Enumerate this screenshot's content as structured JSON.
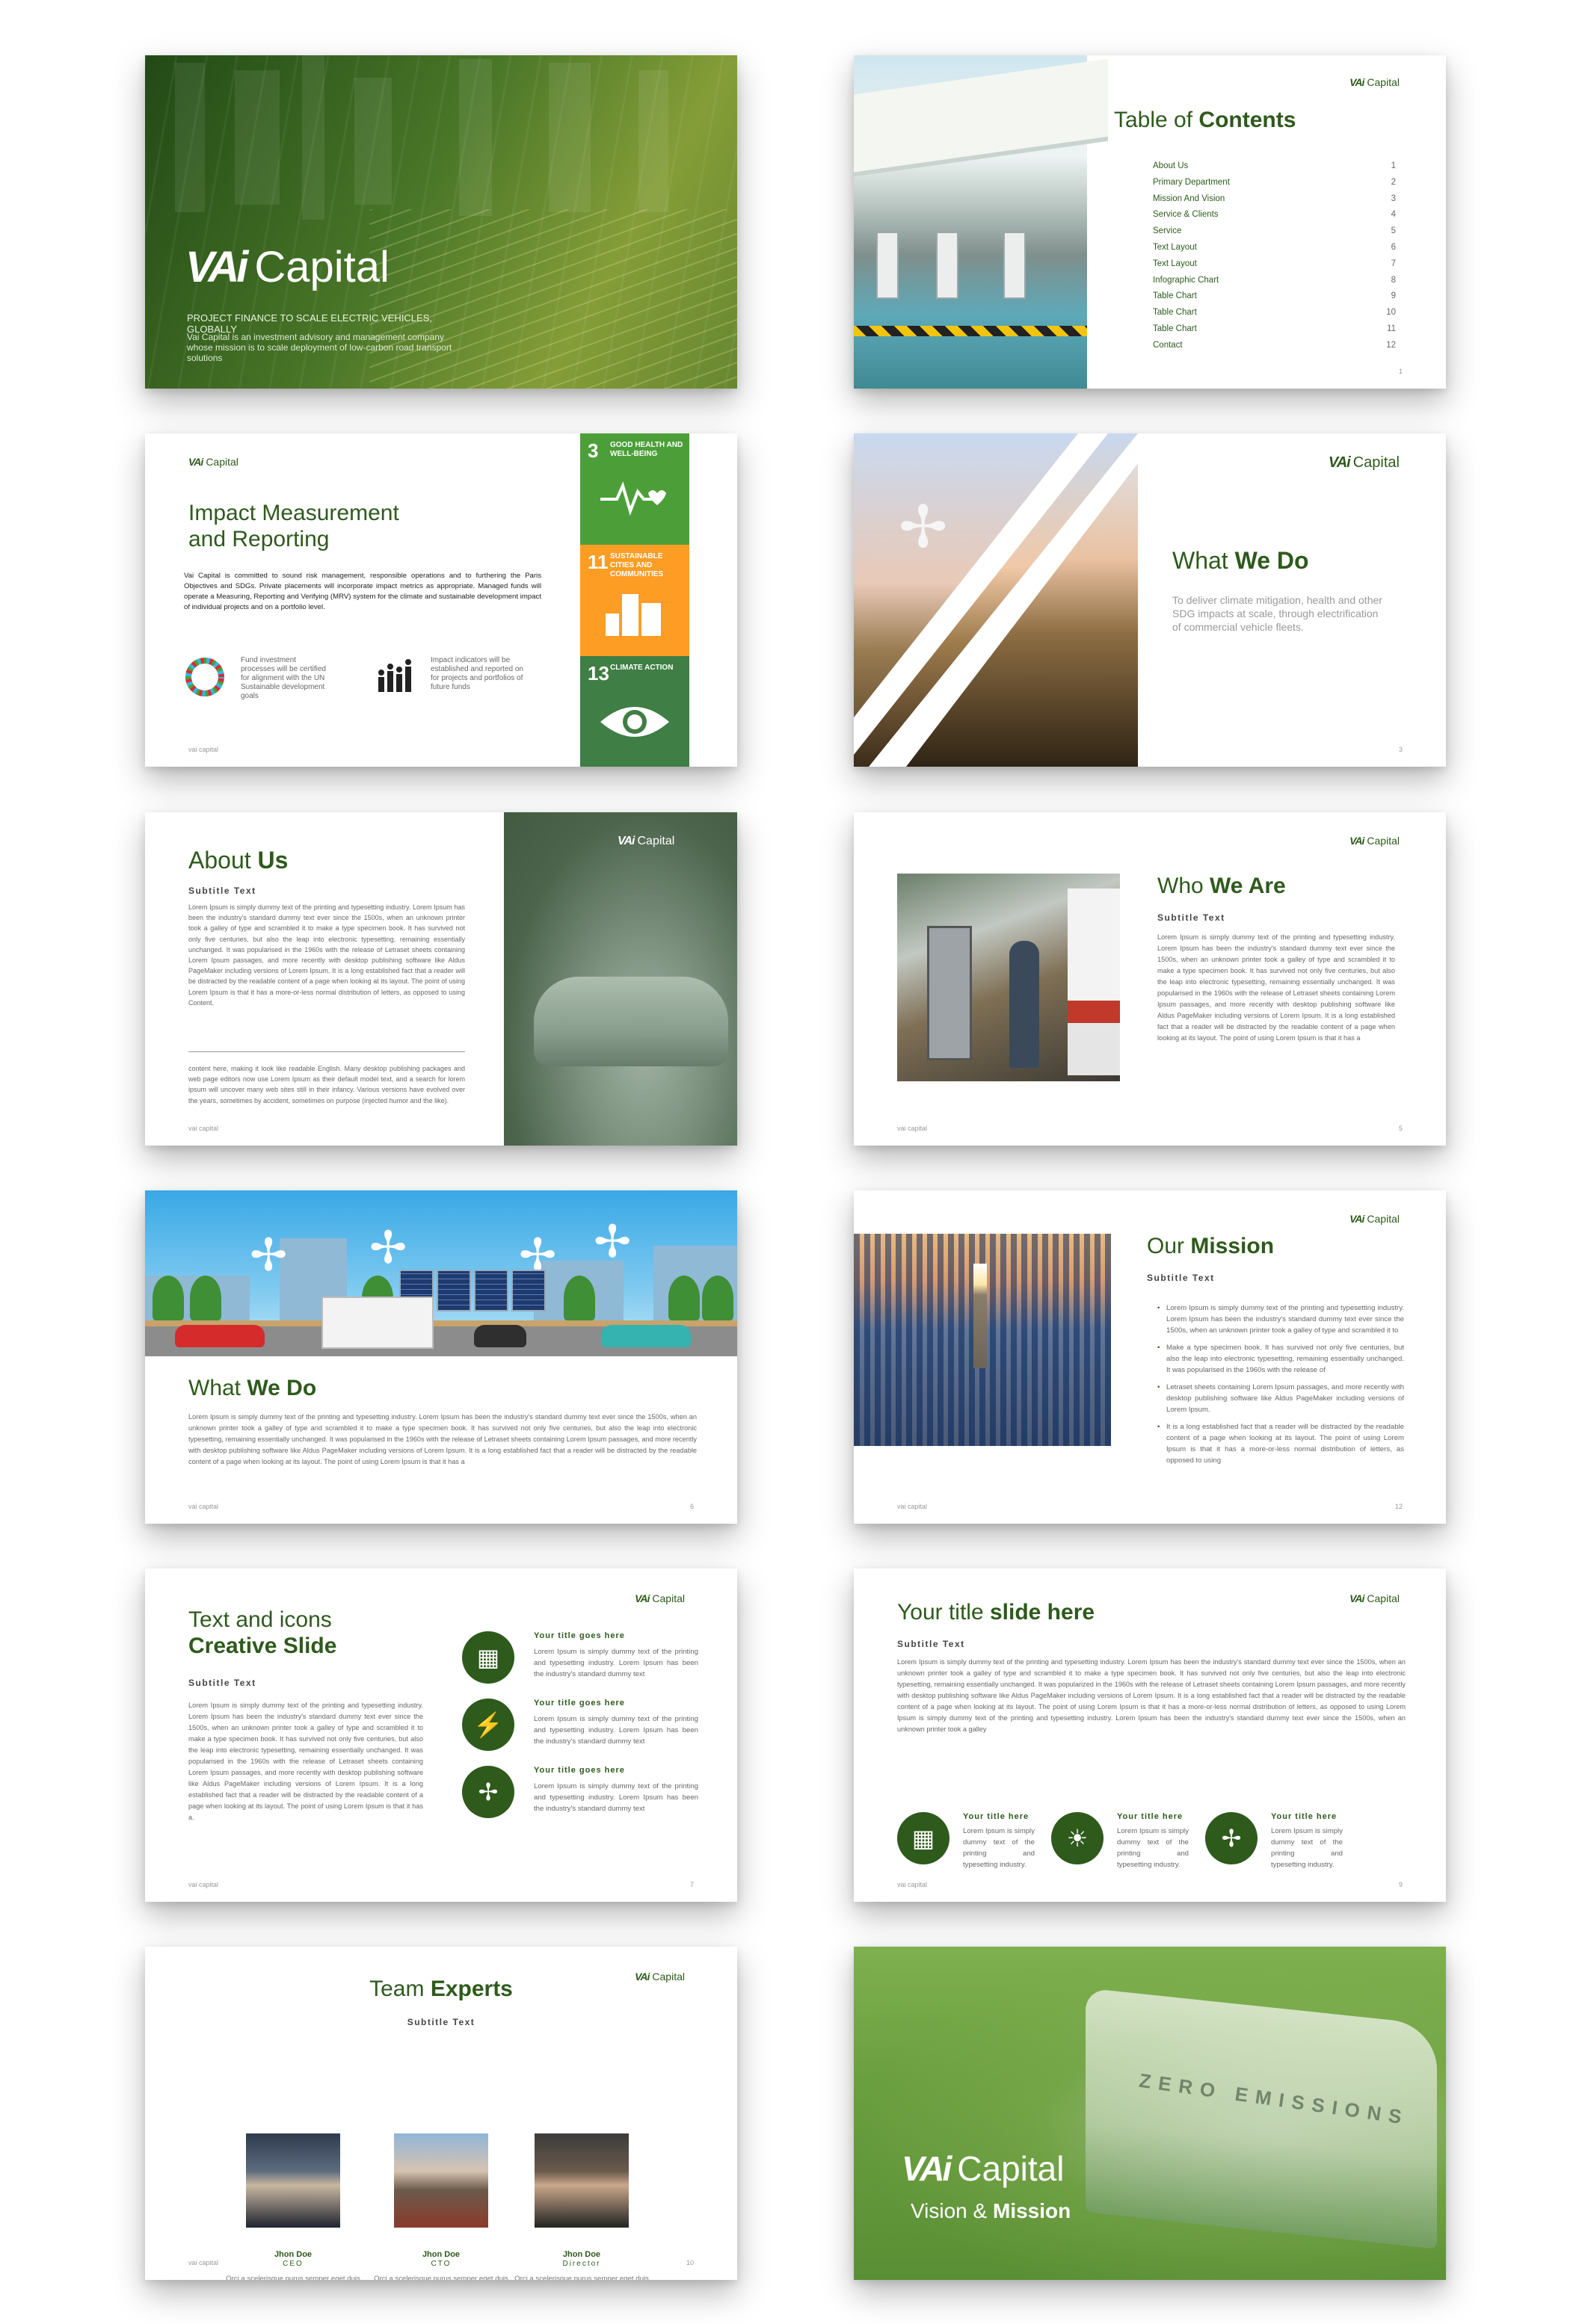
{
  "brand": {
    "mark": "VAi",
    "word": "Capital",
    "footer": "vai capital"
  },
  "cover": {
    "tagline": "PROJECT FINANCE TO SCALE ELECTRIC VEHICLES, GLOBALLY",
    "description": "Vai Capital is an investment advisory and management company whose mission is to scale deployment of low-carbon road transport solutions"
  },
  "toc": {
    "title_a": "Table of ",
    "title_b": "Contents",
    "page": "1",
    "items": [
      {
        "label": "About Us",
        "num": "1"
      },
      {
        "label": "Primary Department",
        "num": "2"
      },
      {
        "label": "Mission And Vision",
        "num": "3"
      },
      {
        "label": "Service & Clients",
        "num": "4"
      },
      {
        "label": "Service",
        "num": "5"
      },
      {
        "label": "Text Layout",
        "num": "6"
      },
      {
        "label": "Text Layout",
        "num": "7"
      },
      {
        "label": "Infographic Chart",
        "num": "8"
      },
      {
        "label": "Table Chart",
        "num": "9"
      },
      {
        "label": "Table Chart",
        "num": "10"
      },
      {
        "label": "Table Chart",
        "num": "11"
      },
      {
        "label": "Contact",
        "num": "12"
      }
    ]
  },
  "impact": {
    "title_a": "Impact ",
    "title_b": "Measurement",
    "title_c": "and Reporting",
    "body": "Vai Capital is committed to sound risk management, responsible operations and to furthering the Paris Objectives and SDGs. Private placements will incorporate impact metrics as appropriate. Managed funds will operate a Measuring, Reporting and Verifying (MRV) system for the climate and sustainable development impact of individual projects and on a portfolio level.",
    "feat1": "Fund investment processes will be certified for alignment with the UN Sustainable development goals",
    "feat2": "Impact indicators will be established and reported on for projects and portfolios of future funds",
    "page": "2",
    "sdgs": [
      {
        "num": "3",
        "label": "GOOD HEALTH AND WELL-BEING",
        "color": "#4c9f38",
        "icon": "heartbeat-icon"
      },
      {
        "num": "11",
        "label": "SUSTAINABLE CITIES AND COMMUNITIES",
        "color": "#fd9d24",
        "icon": "city-icon"
      },
      {
        "num": "13",
        "label": "CLIMATE ACTION",
        "color": "#3f7e44",
        "icon": "eye-globe-icon"
      }
    ]
  },
  "whatwedo1": {
    "title_a": "What ",
    "title_b": "We Do",
    "body": "To deliver climate mitigation, health and other SDG impacts at scale, through electrification of commercial vehicle fleets.",
    "page": "3"
  },
  "about": {
    "title_a": "About ",
    "title_b": "Us",
    "subtitle": "Subtitle Text",
    "body": "Lorem Ipsum is simply dummy text of the printing and typesetting industry. Lorem Ipsum has been the industry's standard dummy text ever since the 1500s, when an unknown printer took a galley of type and scrambled it to make a type specimen book. It has survived not only five centuries, but also the leap into electronic typesetting, remaining essentially unchanged. It was popularised in the 1960s with the release of Letraset sheets containing Lorem Ipsum passages, and more recently with desktop publishing software like Aldus PageMaker including versions of Lorem Ipsum. It is a long established fact that a reader will be distracted by the readable content of a page when looking at its layout. The point of using Lorem Ipsum is that it has a more-or-less normal distribution of letters, as opposed to using Content.",
    "body2": "content here, making it look like readable English. Many desktop publishing packages and web page editors now use Lorem Ipsum as their default model text, and a search for lorem ipsum will uncover many web sites still in their infancy. Various versions have evolved over the years, sometimes by accident, sometimes on purpose (injected humor and the like).",
    "page": "4"
  },
  "who": {
    "title_a": "Who ",
    "title_b": "We Are",
    "subtitle": "Subtitle Text",
    "body": "Lorem Ipsum is simply dummy text of the printing and typesetting industry. Lorem Ipsum has been the industry's standard dummy text ever since the 1500s, when an unknown printer took a galley of type and scrambled it to make a type specimen book. It has survived not only five centuries, but also the leap into electronic typesetting, remaining essentially unchanged. It was popularised in the 1960s with the release of Letraset sheets containing Lorem Ipsum passages, and more recently with desktop publishing software like Aldus PageMaker including versions of Lorem Ipsum. It is a long established fact that a reader will be distracted by the readable content of a page when looking at its layout. The point of using Lorem Ipsum is that it has a",
    "page": "5"
  },
  "whatwedo2": {
    "title_a": "What ",
    "title_b": "We Do",
    "body": "Lorem Ipsum is simply dummy text of the printing and typesetting industry. Lorem Ipsum has been the industry's standard dummy text ever since the 1500s, when an unknown printer took a galley of type and scrambled it to make a type specimen book. It has survived not only five centuries, but also the leap into electronic typesetting, remaining essentially unchanged. It was popularised in the 1960s with the release of Letraset sheets containing Lorem Ipsum passages, and more recently with desktop publishing software like Aldus PageMaker including versions of Lorem Ipsum. It is a long established fact that a reader will be distracted by the readable content of a page when looking at its layout. The point of using Lorem Ipsum is that it has a",
    "page": "6"
  },
  "mission": {
    "title_a": "Our ",
    "title_b": "Mission",
    "subtitle": "Subtitle Text",
    "bullets": [
      "Lorem Ipsum is simply dummy text of the printing and typesetting industry. Lorem Ipsum has been the industry's standard dummy text ever since the 1500s, when an unknown printer took a galley of type and scrambled it to",
      "Make a type specimen book. It has survived not only five centuries, but also the leap into electronic typesetting, remaining essentially unchanged. It was popularised in the 1960s with the release of",
      "Letraset sheets containing Lorem Ipsum passages, and more recently with desktop publishing software like Aldus PageMaker including versions of Lorem Ipsum.",
      "It is a long established fact that a reader will be distracted by the readable content of a page when looking at its layout. The point of using Lorem Ipsum is that it has a more-or-less normal distribution of letters, as opposed to using"
    ],
    "page": "12"
  },
  "creative": {
    "title_a": "Text and icons",
    "title_b": "Creative Slide",
    "subtitle": "Subtitle Text",
    "body": "Lorem Ipsum is simply dummy text of the printing and typesetting industry. Lorem Ipsum has been the industry's standard dummy text ever since the 1500s, when an unknown printer took a galley of type and scrambled it to make a type specimen book. It has survived not only five centuries, but also the leap into electronic typesetting, remaining essentially unchanged. It was popularised in the 1960s with the release of Letraset sheets containing Lorem Ipsum passages, and more recently with desktop publishing software like Aldus PageMaker including versions of Lorem Ipsum. It is a long established fact that a reader will be distracted by the readable content of a page when looking at its layout. The point of using Lorem Ipsum is that it has a.",
    "items": [
      {
        "title": "Your title goes here",
        "text": "Lorem Ipsum is simply dummy text of the printing and typesetting industry. Lorem Ipsum has been the industry's standard dummy text",
        "icon": "solar-panel-icon"
      },
      {
        "title": "Your title goes here",
        "text": "Lorem Ipsum is simply dummy text of the printing and typesetting industry. Lorem Ipsum has been the industry's standard dummy text",
        "icon": "ev-plug-icon"
      },
      {
        "title": "Your title goes here",
        "text": "Lorem Ipsum is simply dummy text of the printing and typesetting industry. Lorem Ipsum has been the industry's standard dummy text",
        "icon": "wind-turbine-icon"
      }
    ],
    "page": "7"
  },
  "yourtitle": {
    "title_a": "Your title ",
    "title_b": "slide here",
    "subtitle": "Subtitle Text",
    "body": "Lorem Ipsum is simply dummy text of the printing and typesetting industry. Lorem Ipsum has been the industry's standard dummy text ever since the 1500s, when an unknown printer took a galley of type and scrambled it to make a type specimen book. It has survived not only five centuries, but also the leap into electronic typesetting, remaining essentially unchanged. It was popularized in the 1960s with the release of Letraset sheets containing Lorem Ipsum passages, and more recently with desktop publishing software like Aldus PageMaker including versions of Lorem Ipsum. It is a long established fact that a reader will be distracted by the readable content of a page when looking at its layout. The point of using Lorem Ipsum is that it has a more-or-less normal distribution of letters, as opposed to using Lorem Ipsum is simply dummy text of the printing and typesetting industry. Lorem Ipsum has been the industry's standard dummy text ever since the 1500s, when an unknown printer took a galley",
    "items": [
      {
        "title": "Your title here",
        "text": "Lorem Ipsum is simply dummy text of the printing and typesetting industry.",
        "icon": "solar-panel-icon"
      },
      {
        "title": "Your title here",
        "text": "Lorem Ipsum is simply dummy text of the printing and typesetting industry.",
        "icon": "sun-leaf-icon"
      },
      {
        "title": "Your title here",
        "text": "Lorem Ipsum is simply dummy text of the printing and typesetting industry.",
        "icon": "wind-turbine-icon"
      }
    ],
    "page": "9"
  },
  "team": {
    "title_a": "Team ",
    "title_b": "Experts",
    "subtitle": "Subtitle Text",
    "members": [
      {
        "name": "Jhon Doe",
        "role": "CEO",
        "desc": "Orci a scelerisque purus semper eget duis at. Enim facilisis gravida neque convallis."
      },
      {
        "name": "Jhon Doe",
        "role": "CTO",
        "desc": "Orci a scelerisque purus semper eget duis at. Enim facilisis gravida neque convallis."
      },
      {
        "name": "Jhon Doe",
        "role": "Director",
        "desc": "Orci a scelerisque purus semper eget duis at. Enim facilisis gravida neque convallis."
      }
    ],
    "page": "10"
  },
  "final": {
    "sub_a": "Vision & ",
    "sub_b": "Mission",
    "bus_text": "ZERO EMISSIONS"
  },
  "colors": {
    "brand_green": "#2e5a1c",
    "sdg3": "#4c9f38",
    "sdg11": "#fd9d24",
    "sdg13": "#3f7e44"
  }
}
